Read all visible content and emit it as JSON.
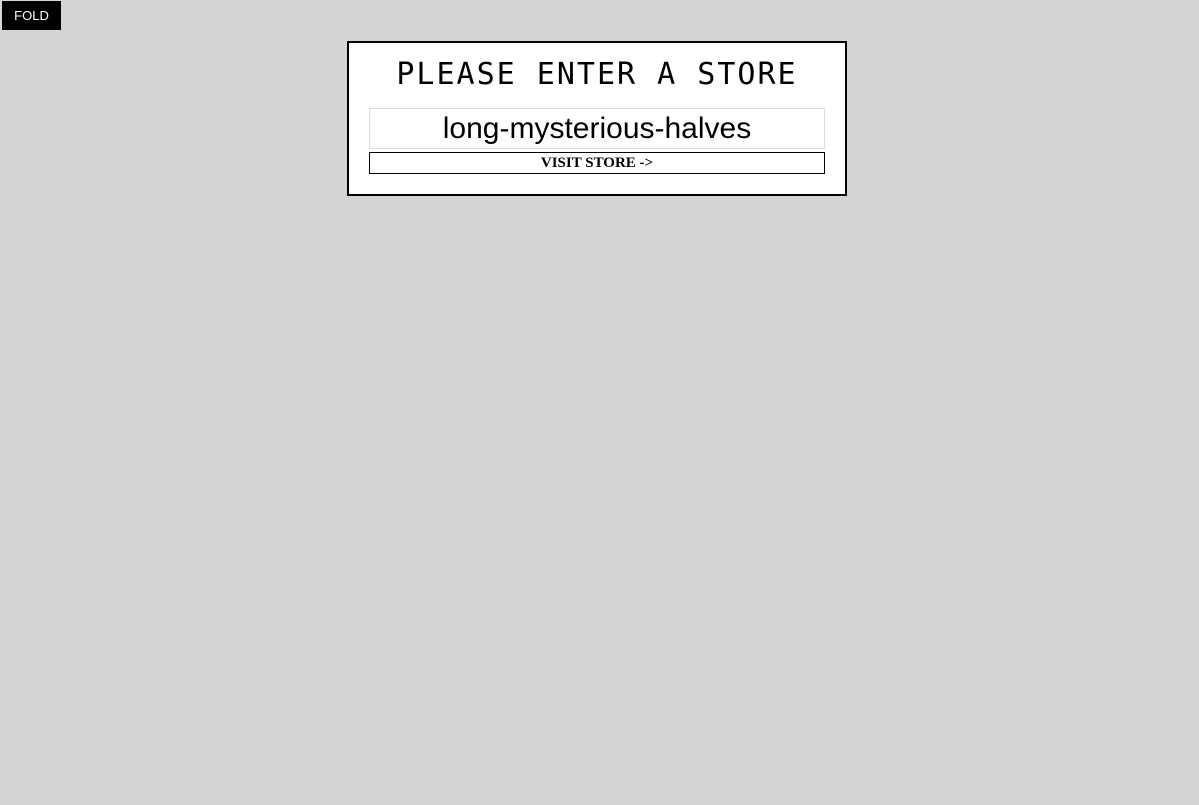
{
  "fold_button": {
    "label": "FOLD"
  },
  "store_panel": {
    "title": "PLEASE ENTER A STORE",
    "input": {
      "value": "long-mysterious-halves"
    },
    "visit_button_label": "VISIT STORE ->"
  }
}
